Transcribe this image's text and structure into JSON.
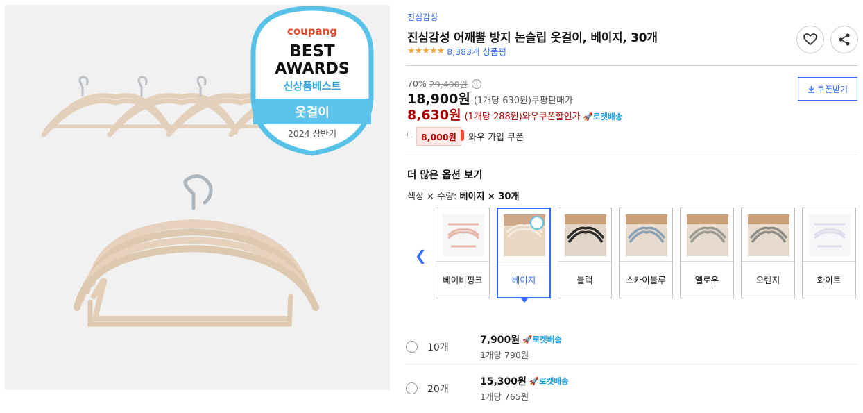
{
  "hero": {
    "badge": {
      "brand": "coupang",
      "line1": "BEST",
      "line2": "AWARDS",
      "line3": "신상품베스트",
      "ribbon": "옷걸이",
      "period": "2024 상반기"
    }
  },
  "product": {
    "brand": "진심감성",
    "title": "진심감성 어깨뿔 방지 논슬립 옷걸이, 베이지, 30개",
    "stars": "★★★★★",
    "review_count": "8,383개 상품평"
  },
  "pricing": {
    "discount_rate": "70%",
    "original_price": "29,400원",
    "info_icon": "ⓘ",
    "sale_price": "18,900원",
    "sale_unit": "(1개당 630원)",
    "sale_label": "쿠팡판매가",
    "wow_price": "8,630원",
    "wow_unit": "(1개당 288원)",
    "wow_label": "와우쿠폰할인가",
    "rocket_label": "로켓배송",
    "coupon_amount": "8,000원",
    "coupon_label": "와우 가입 쿠폰",
    "coupon_button": "쿠폰받기"
  },
  "options": {
    "heading": "더 많은 옵션 보기",
    "selected_prefix": "색상 × 수량:",
    "selected_value": "베이지 × 30개",
    "colors": [
      {
        "label": "베이비핑크",
        "color": "#e8b4a8"
      },
      {
        "label": "베이지",
        "color": "#d9c2a8"
      },
      {
        "label": "블랙",
        "color": "#2a2a2a"
      },
      {
        "label": "스카이블루",
        "color": "#9bb4c8"
      },
      {
        "label": "옐로우",
        "color": "#e6d9a0"
      },
      {
        "label": "오렌지",
        "color": "#d9a070"
      },
      {
        "label": "화이트",
        "color": "#f2f2f2"
      }
    ],
    "quantities": [
      {
        "label": "10개",
        "price": "7,900원",
        "rocket": "로켓배송",
        "unit": "1개당 790원"
      },
      {
        "label": "20개",
        "price": "15,300원",
        "rocket": "로켓배송",
        "unit": "1개당 765원"
      }
    ]
  },
  "colors": {
    "accent": "#346aff",
    "wow_red": "#ae0000",
    "rocket_blue": "#17a0e6",
    "star": "#f4a233"
  }
}
